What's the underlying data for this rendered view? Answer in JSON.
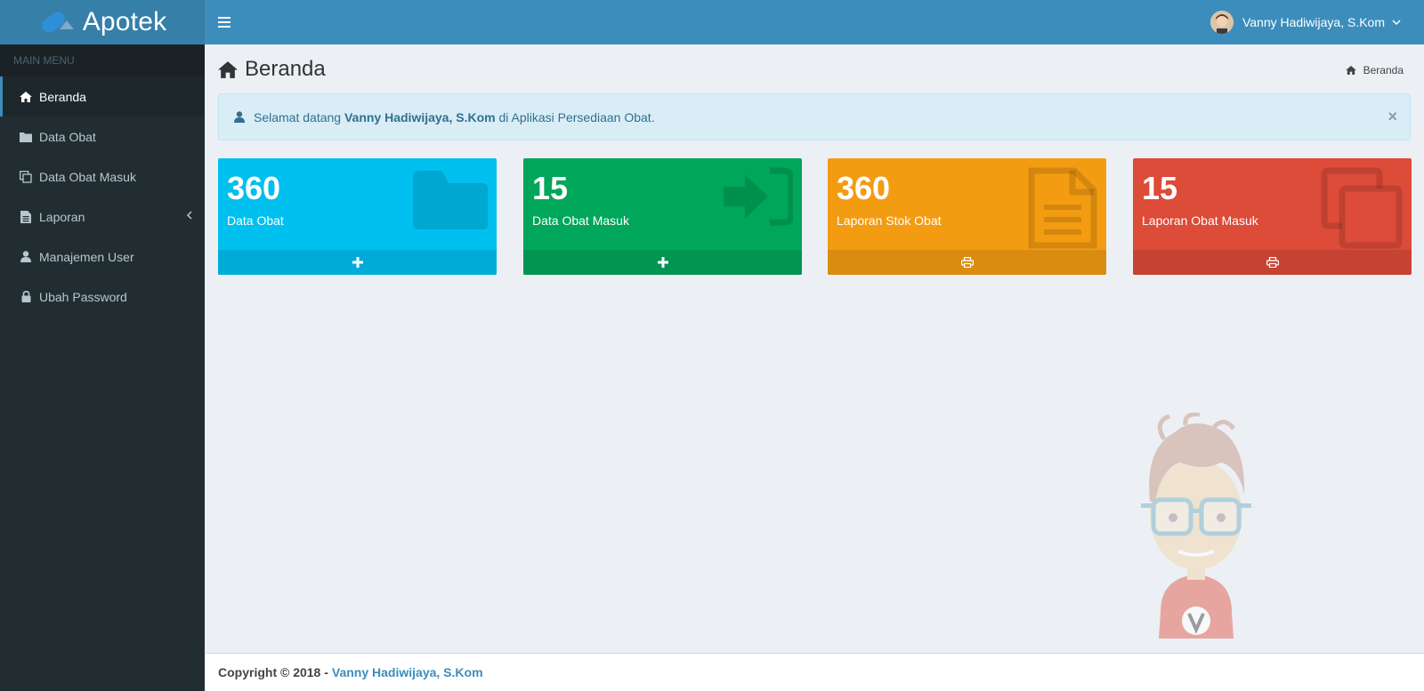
{
  "header": {
    "app_name": "Apotek",
    "user_name": "Vanny Hadiwijaya, S.Kom",
    "bg_color": "#3c8dbc"
  },
  "sidebar": {
    "menu_header": "MAIN MENU",
    "items": [
      {
        "label": "Beranda",
        "icon": "home-icon",
        "active": true
      },
      {
        "label": "Data Obat",
        "icon": "folder-icon"
      },
      {
        "label": "Data Obat Masuk",
        "icon": "copy-icon"
      },
      {
        "label": "Laporan",
        "icon": "file-icon",
        "has_submenu": true
      },
      {
        "label": "Manajemen User",
        "icon": "user-icon"
      },
      {
        "label": "Ubah Password",
        "icon": "lock-icon"
      }
    ]
  },
  "page": {
    "title": "Beranda",
    "breadcrumb": "Beranda"
  },
  "alert": {
    "prefix": "Selamat datang",
    "name": "Vanny Hadiwijaya, S.Kom",
    "suffix": "di Aplikasi Persediaan Obat.",
    "close": "×"
  },
  "boxes": [
    {
      "count": "360",
      "label": "Data Obat",
      "icon": "folder-icon",
      "action_icon": "plus-icon",
      "color": "#00c0ef"
    },
    {
      "count": "15",
      "label": "Data Obat Masuk",
      "icon": "sign-in-icon",
      "action_icon": "plus-icon",
      "color": "#00a65a"
    },
    {
      "count": "360",
      "label": "Laporan Stok Obat",
      "icon": "file-text-icon",
      "action_icon": "print-icon",
      "color": "#f39c12"
    },
    {
      "count": "15",
      "label": "Laporan Obat Masuk",
      "icon": "copy-icon",
      "action_icon": "print-icon",
      "color": "#dd4b39"
    }
  ],
  "footer": {
    "text": "Copyright © 2018 -",
    "link": "Vanny Hadiwijaya, S.Kom"
  }
}
